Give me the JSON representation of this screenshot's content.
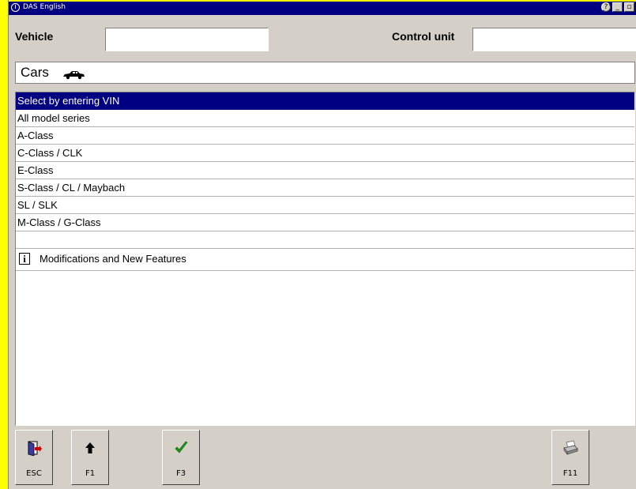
{
  "window": {
    "title": "DAS English"
  },
  "header": {
    "vehicle_label": "Vehicle",
    "vehicle_value": "",
    "control_unit_label": "Control unit",
    "control_unit_value": ""
  },
  "category": {
    "label": "Cars",
    "icon": "car-icon"
  },
  "list": {
    "items": [
      {
        "label": "Select by entering VIN",
        "selected": true
      },
      {
        "label": "All model series"
      },
      {
        "label": "A-Class"
      },
      {
        "label": "C-Class / CLK"
      },
      {
        "label": "E-Class"
      },
      {
        "label": "S-Class / CL / Maybach"
      },
      {
        "label": "SL / SLK"
      },
      {
        "label": "M-Class / G-Class"
      },
      {
        "label": ""
      }
    ],
    "info_item": {
      "label": "Modifications and New Features",
      "icon": "info-icon"
    }
  },
  "toolbar": {
    "buttons": [
      {
        "label": "ESC",
        "icon": "exit-door-icon"
      },
      {
        "label": "F1",
        "icon": "arrow-up-icon"
      },
      {
        "label": "F3",
        "icon": "checkmark-icon"
      },
      {
        "label": "F11",
        "icon": "printer-icon"
      }
    ]
  },
  "colors": {
    "selection": "#000080",
    "chrome": "#d4d0c8",
    "background": "#ffff00"
  }
}
